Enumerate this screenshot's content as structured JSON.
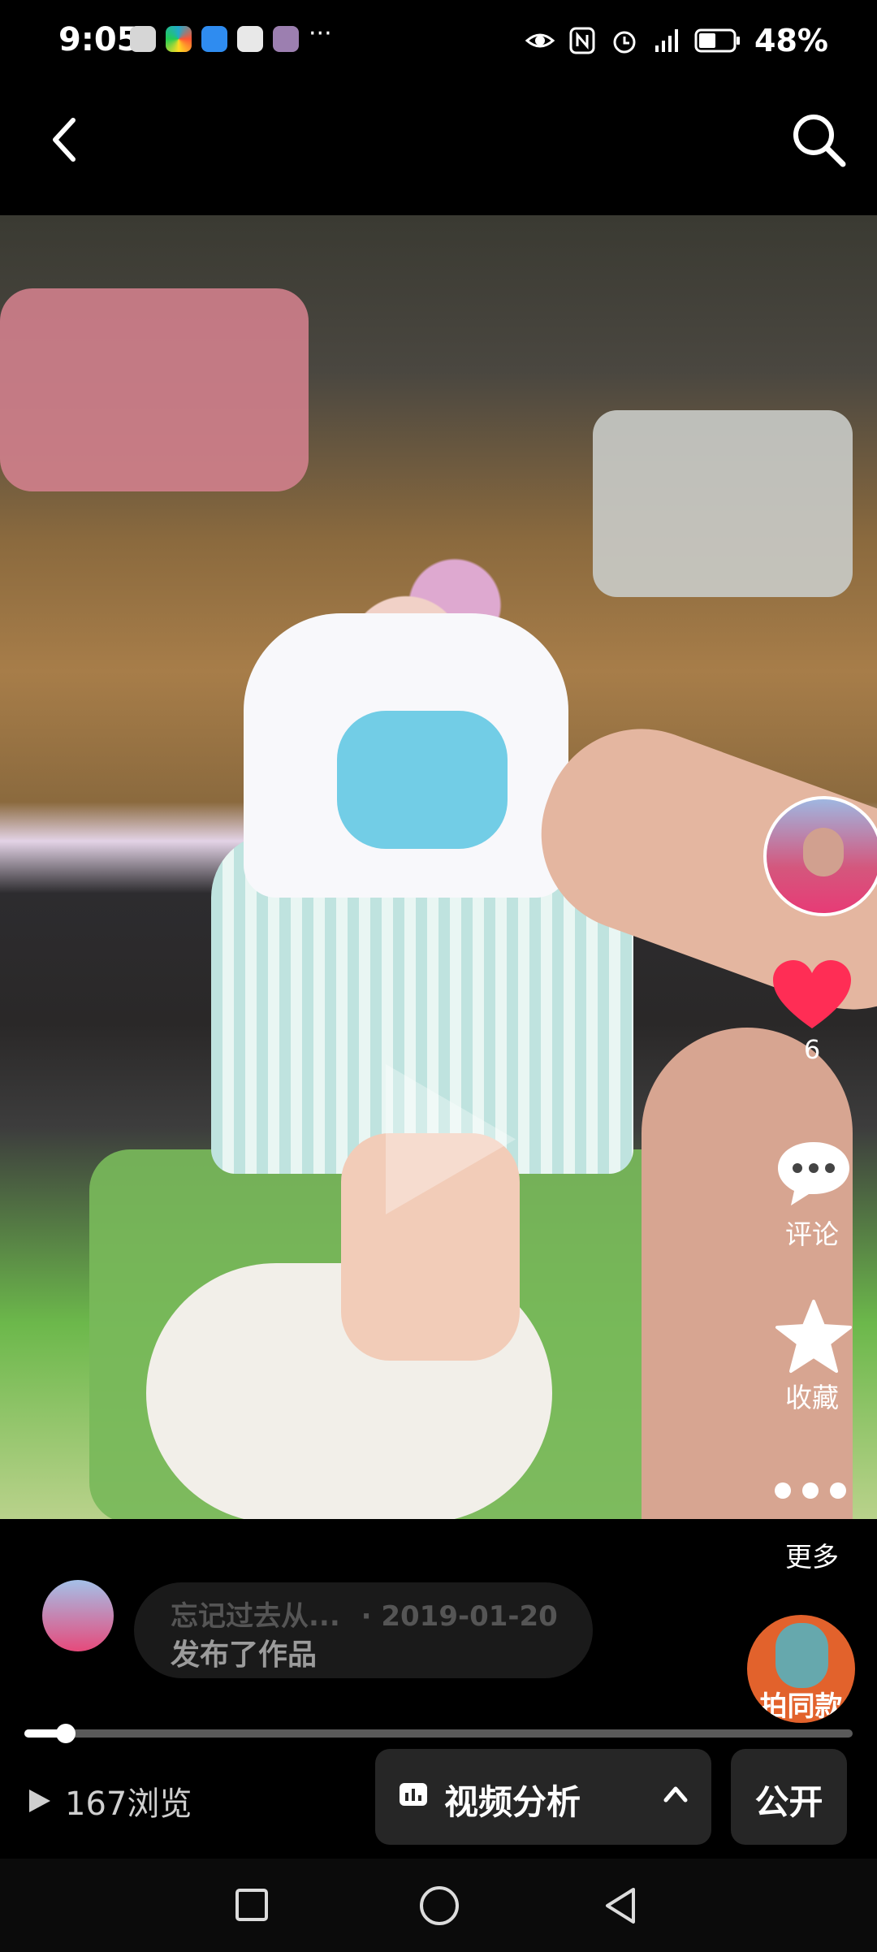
{
  "status_bar": {
    "time": "9:05",
    "battery": "48%",
    "network": "4G"
  },
  "nav": {
    "back_icon": "chevron-left-icon",
    "search_icon": "search-icon"
  },
  "media": {
    "description": "child standing on play mat",
    "play_icon": "play-icon"
  },
  "rail": {
    "like_count": "6",
    "comment_label": "评论",
    "favorite_label": "收藏",
    "more_label": "更多",
    "like_color": "#ff2d55"
  },
  "publish": {
    "author": "忘记过去从...",
    "date": "· 2019-01-20",
    "action": "发布了作品"
  },
  "same_style": {
    "label": "拍同款"
  },
  "progress": {
    "fraction": 0.05
  },
  "bottom": {
    "views": "167浏览",
    "analysis_label": "视频分析",
    "public_label": "公开"
  }
}
